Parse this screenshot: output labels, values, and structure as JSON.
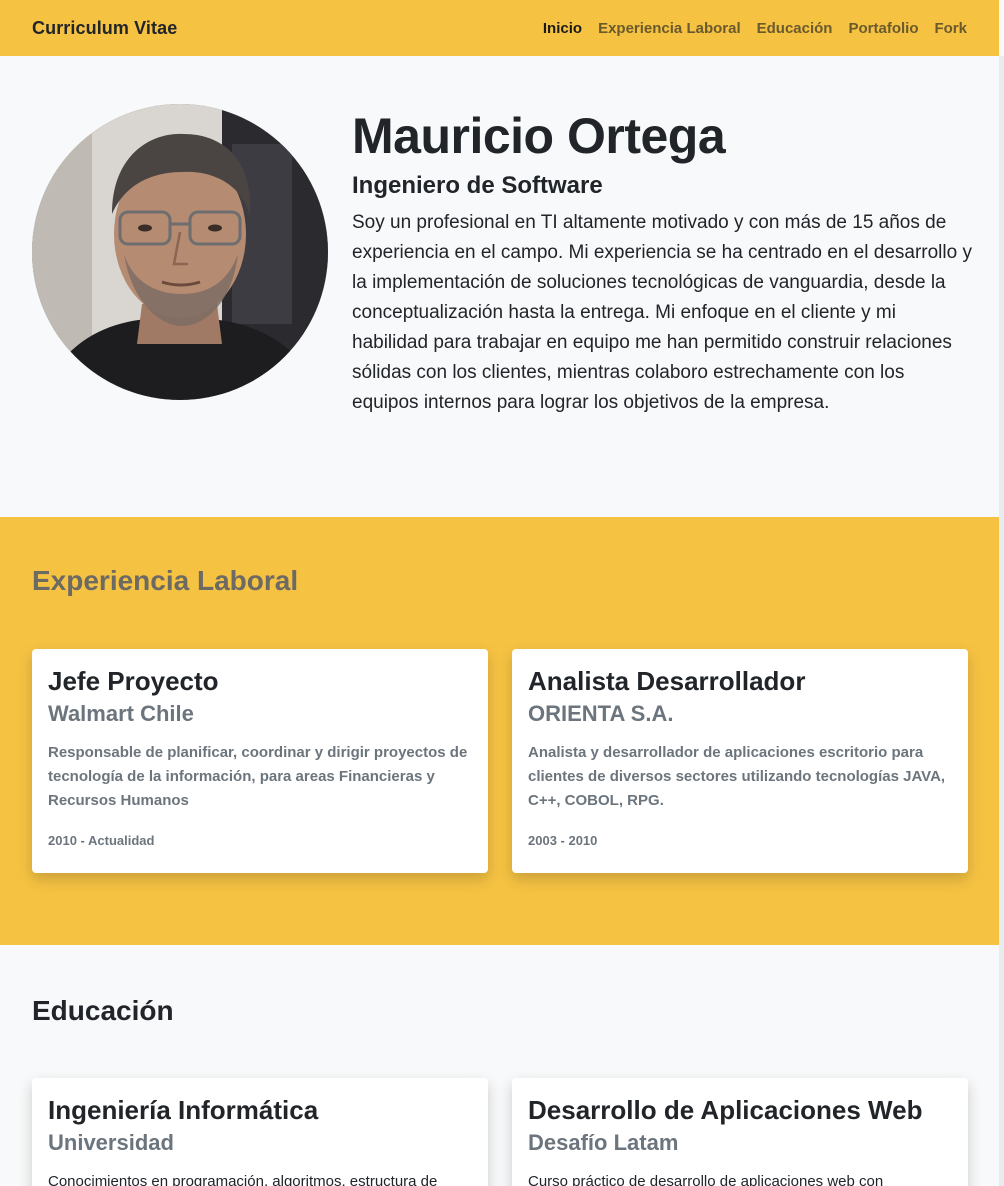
{
  "navbar": {
    "brand": "Curriculum Vitae",
    "links": [
      "Inicio",
      "Experiencia Laboral",
      "Educación",
      "Portafolio",
      "Fork"
    ]
  },
  "hero": {
    "name": "Mauricio Ortega",
    "role": "Ingeniero de Software",
    "about": "Soy un profesional en TI altamente motivado y con más de 15 años de experiencia en el campo. Mi experiencia se ha centrado en el desarrollo y la implementación de soluciones tecnológicas de vanguardia, desde la conceptualización hasta la entrega. Mi enfoque en el cliente y mi habilidad para trabajar en equipo me han permitido construir relaciones sólidas con los clientes, mientras colaboro estrechamente con los equipos internos para lograr los objetivos de la empresa."
  },
  "experience": {
    "title": "Experiencia Laboral",
    "items": [
      {
        "title": "Jefe Proyecto",
        "company": "Walmart Chile",
        "description": "Responsable de planificar, coordinar y dirigir proyectos de tecnología de la información, para areas Financieras y Recursos Humanos",
        "dates": "2010 - Actualidad"
      },
      {
        "title": "Analista Desarrollador",
        "company": "ORIENTA S.A.",
        "description": "Analista y desarrollador de aplicaciones escritorio para clientes de diversos sectores utilizando tecnologías JAVA, C++, COBOL, RPG.",
        "dates": "2003 - 2010"
      }
    ]
  },
  "education": {
    "title": "Educación",
    "items": [
      {
        "title": "Ingeniería Informática",
        "institution": "Universidad",
        "description": "Conocimientos en programación, algoritmos, estructura de"
      },
      {
        "title": "Desarrollo de Aplicaciones Web",
        "institution": "Desafío Latam",
        "description": "Curso práctico de desarrollo de aplicaciones web con"
      }
    ]
  },
  "colors": {
    "accent": "#f5c242",
    "muted_text": "#6c757d",
    "page_bg": "#f8f9fa"
  }
}
